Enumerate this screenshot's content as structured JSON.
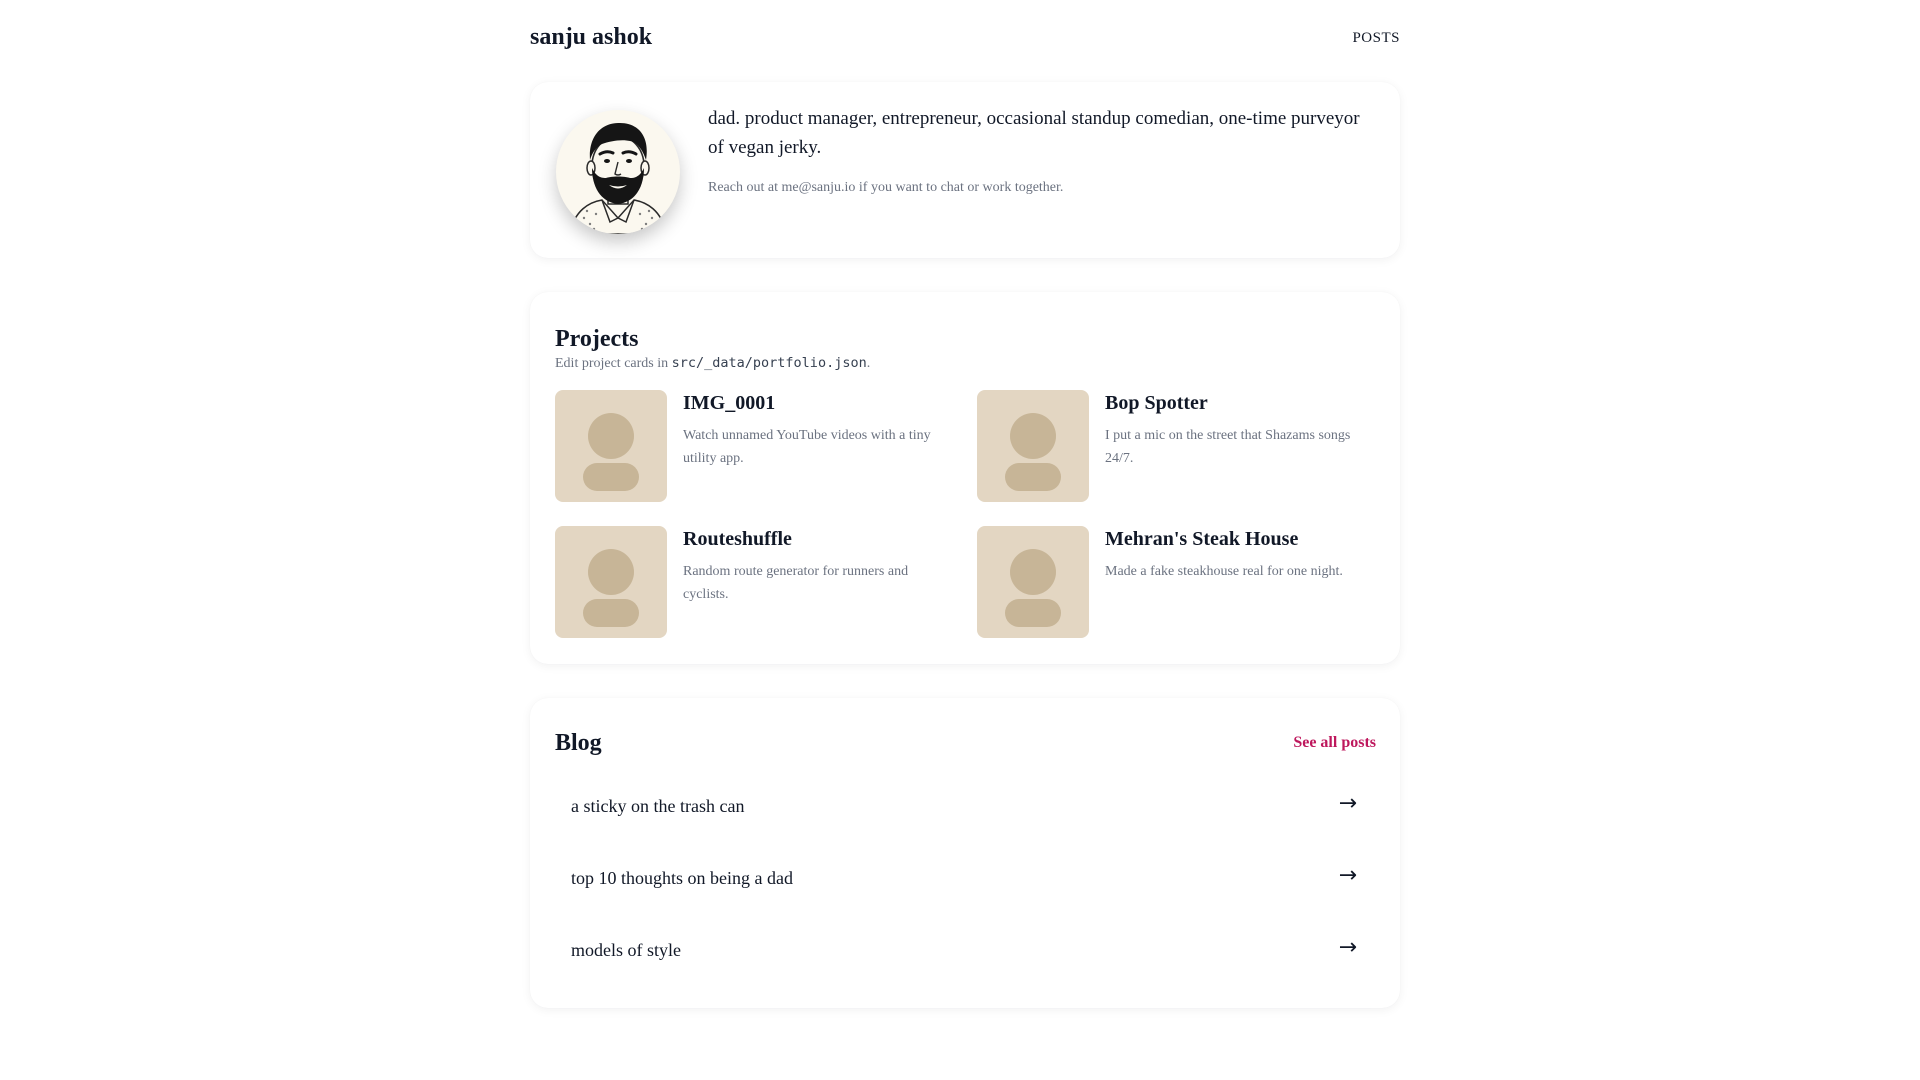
{
  "header": {
    "site_title": "sanju ashok",
    "nav_posts": "POSTS"
  },
  "hero": {
    "avatar_icon": "bearded-man-illustration-icon",
    "bio": "dad. product manager, entrepreneur, occasional standup comedian, one-time purveyor of vegan jerky.",
    "contact": "Reach out at me@sanju.io if you want to chat or work together."
  },
  "projects": {
    "title": "Projects",
    "note_prefix": "Edit project cards in ",
    "note_path": "src/_data/portfolio.json",
    "note_suffix": ".",
    "items": [
      {
        "name": "IMG_0001",
        "description": "Watch unnamed YouTube videos with a tiny utility app.",
        "thumb_icon": "placeholder-person-icon"
      },
      {
        "name": "Bop Spotter",
        "description": "I put a mic on the street that Shazams songs 24/7.",
        "thumb_icon": "placeholder-person-icon"
      },
      {
        "name": "Routeshuffle",
        "description": "Random route generator for runners and cyclists.",
        "thumb_icon": "placeholder-person-icon"
      },
      {
        "name": "Mehran's Steak House",
        "description": "Made a fake steakhouse real for one night.",
        "thumb_icon": "placeholder-person-icon"
      }
    ]
  },
  "blog": {
    "title": "Blog",
    "see_all": "See all posts",
    "posts": [
      {
        "title": "a sticky on the trash can",
        "arrow": "→"
      },
      {
        "title": "top 10 thoughts on being a dad",
        "arrow": "→"
      },
      {
        "title": "models of style",
        "arrow": "→"
      }
    ]
  },
  "colors": {
    "accent_link": "#be185d",
    "text_primary": "#111827",
    "text_muted": "#6b7280",
    "thumb_bg": "#e3d6c2",
    "thumb_figure": "#c7b597"
  }
}
